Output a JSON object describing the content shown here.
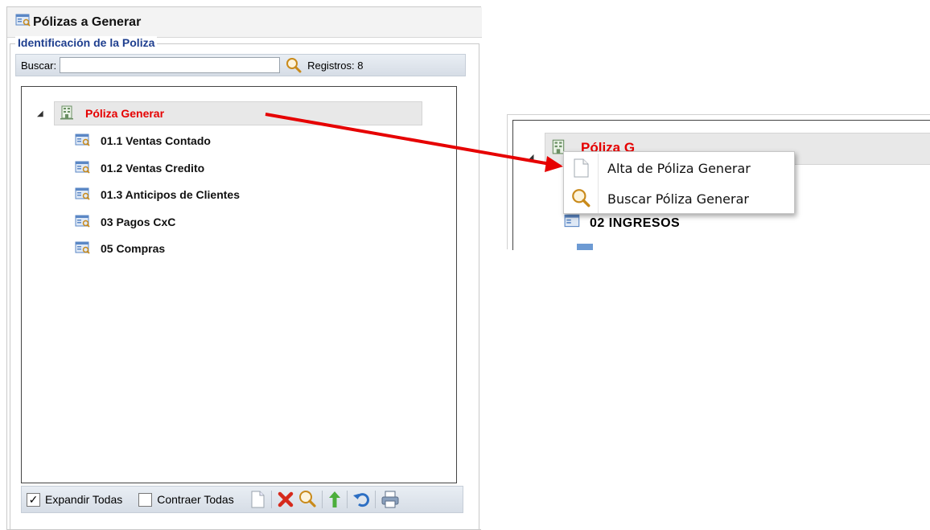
{
  "panel": {
    "title": "Pólizas a Generar",
    "fieldset_legend": "Identificación de la Poliza",
    "search": {
      "label": "Buscar:",
      "value": "",
      "placeholder": ""
    },
    "records_label": "Registros: 8"
  },
  "tree": {
    "root": {
      "label": "Póliza Generar",
      "expanded": true
    },
    "items": [
      {
        "label": "01.1 Ventas Contado"
      },
      {
        "label": "01.2 Ventas Credito"
      },
      {
        "label": "01.3 Anticipos de Clientes"
      },
      {
        "label": "03 Pagos CxC"
      },
      {
        "label": "05 Compras"
      }
    ]
  },
  "bottom_toolbar": {
    "expand_all": {
      "label": "Expandir Todas",
      "checked": true
    },
    "collapse_all": {
      "label": "Contraer Todas",
      "checked": false
    },
    "icons": [
      "new-document-icon",
      "delete-icon",
      "search-icon",
      "move-up-icon",
      "undo-icon",
      "print-icon"
    ]
  },
  "inset": {
    "root_label_partial": "Póliza G",
    "item_label": "02 INGRESOS"
  },
  "context_menu": {
    "items": [
      {
        "label": "Alta de Póliza Generar",
        "icon": "new-document-icon"
      },
      {
        "label": "Buscar Póliza Generar",
        "icon": "search-icon"
      }
    ]
  },
  "colors": {
    "accent_red": "#e60000",
    "legend_blue": "#1f3f8f",
    "arrow": "#e60000"
  }
}
